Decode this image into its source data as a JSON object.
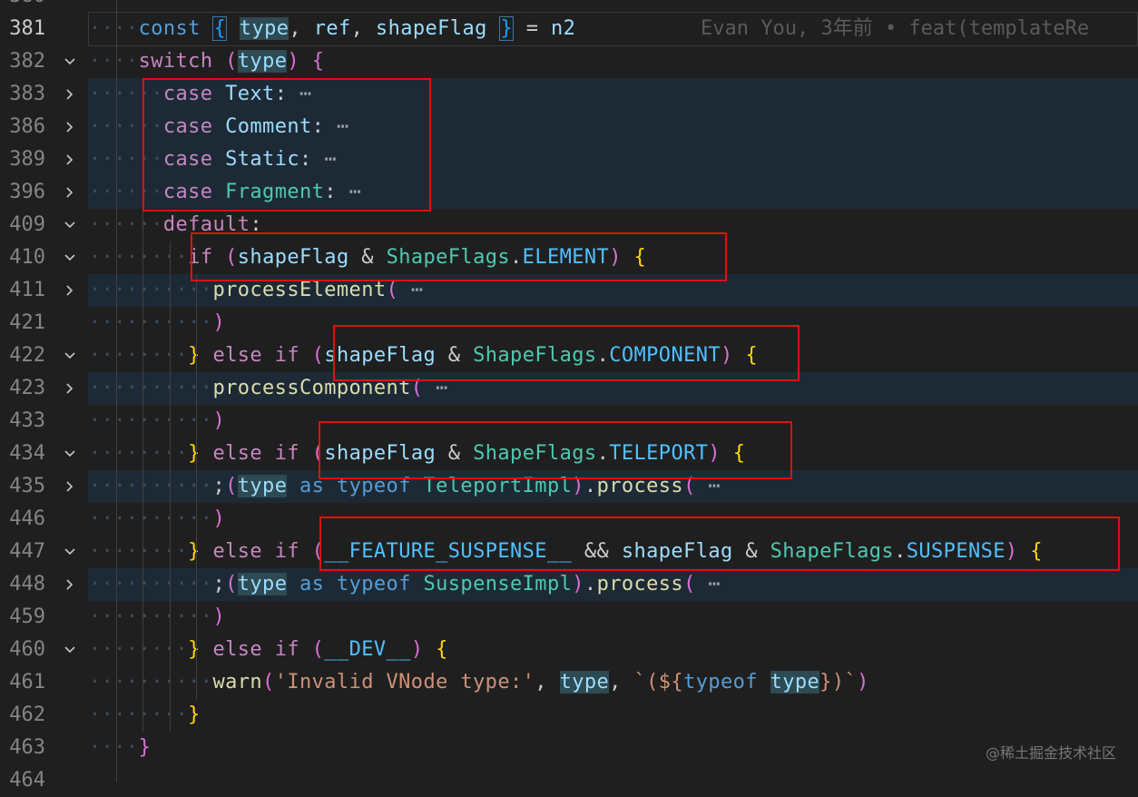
{
  "top_partial_line": "380",
  "lines": [
    {
      "num": "381",
      "fold": "none"
    },
    {
      "num": "382",
      "fold": "open"
    },
    {
      "num": "383",
      "fold": "closed"
    },
    {
      "num": "386",
      "fold": "closed"
    },
    {
      "num": "389",
      "fold": "closed"
    },
    {
      "num": "396",
      "fold": "closed"
    },
    {
      "num": "409",
      "fold": "open"
    },
    {
      "num": "410",
      "fold": "open"
    },
    {
      "num": "411",
      "fold": "closed"
    },
    {
      "num": "421",
      "fold": "none"
    },
    {
      "num": "422",
      "fold": "open"
    },
    {
      "num": "423",
      "fold": "closed"
    },
    {
      "num": "433",
      "fold": "none"
    },
    {
      "num": "434",
      "fold": "open"
    },
    {
      "num": "435",
      "fold": "closed"
    },
    {
      "num": "446",
      "fold": "none"
    },
    {
      "num": "447",
      "fold": "open"
    },
    {
      "num": "448",
      "fold": "closed"
    },
    {
      "num": "459",
      "fold": "none"
    },
    {
      "num": "460",
      "fold": "open"
    },
    {
      "num": "461",
      "fold": "none"
    },
    {
      "num": "462",
      "fold": "none"
    },
    {
      "num": "463",
      "fold": "none"
    }
  ],
  "bottom_partial_line": "464",
  "code": {
    "l381": {
      "kw": "const",
      "b1": "{",
      "v1": "type",
      "v2": "ref",
      "v3": "shapeFlag",
      "b2": "}",
      "eq": "=",
      "rhs": "n2"
    },
    "blame": "Evan You, 3年前 • feat(templateRe",
    "l382": {
      "kw": "switch",
      "arg": "type"
    },
    "l383": {
      "kw": "case",
      "name": "Text"
    },
    "l386": {
      "kw": "case",
      "name": "Comment"
    },
    "l389": {
      "kw": "case",
      "name": "Static"
    },
    "l396": {
      "kw": "case",
      "name": "Fragment"
    },
    "l409": {
      "kw": "default"
    },
    "l410": {
      "kw": "if",
      "v": "shapeFlag",
      "op": "&",
      "cls": "ShapeFlags",
      "prop": "ELEMENT"
    },
    "l411": {
      "fn": "processElement"
    },
    "l422": {
      "kw": "else if",
      "v": "shapeFlag",
      "op": "&",
      "cls": "ShapeFlags",
      "prop": "COMPONENT"
    },
    "l423": {
      "fn": "processComponent"
    },
    "l434": {
      "kw": "else if",
      "v": "shapeFlag",
      "op": "&",
      "cls": "ShapeFlags",
      "prop": "TELEPORT"
    },
    "l435": {
      "v": "type",
      "as": "as",
      "typeof": "typeof",
      "cls": "TeleportImpl",
      "fn": "process"
    },
    "l447": {
      "kw": "else if",
      "flag": "__FEATURE_SUSPENSE__",
      "and": "&&",
      "v": "shapeFlag",
      "op": "&",
      "cls": "ShapeFlags",
      "prop": "SUSPENSE"
    },
    "l448": {
      "v": "type",
      "as": "as",
      "typeof": "typeof",
      "cls": "SuspenseImpl",
      "fn": "process"
    },
    "l460": {
      "kw": "else if",
      "flag": "__DEV__"
    },
    "l461": {
      "fn": "warn",
      "str": "'Invalid VNode type:'",
      "v": "type",
      "tmpl1": "`(${",
      "typeof": "typeof",
      "v2": "type",
      "tmpl2": "})`"
    }
  },
  "ellipsis": "⋯",
  "watermark": "@稀土掘金技术社区",
  "colors": {
    "highlight_box": "#e01010",
    "keyword": "#c586c0",
    "class": "#4ec9b0",
    "variable": "#9cdcfe"
  }
}
